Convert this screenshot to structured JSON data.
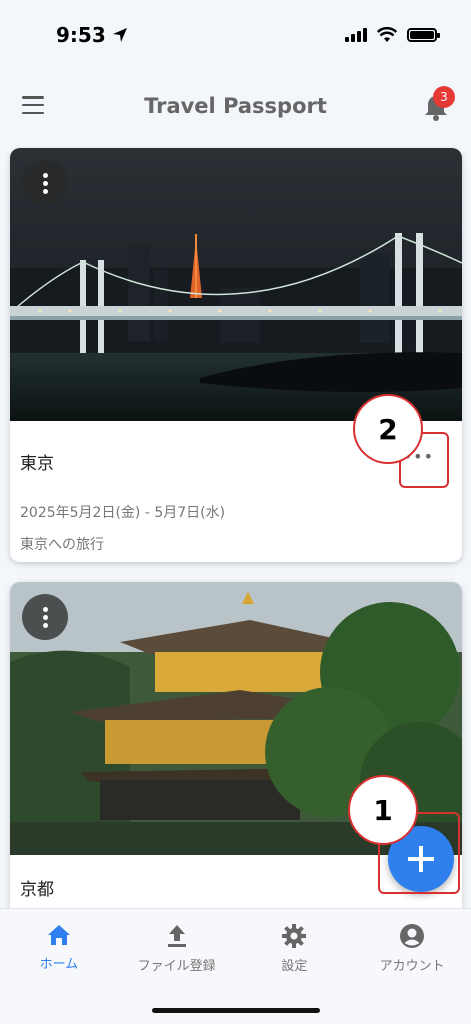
{
  "status_bar": {
    "time": "9:53"
  },
  "app_bar": {
    "title": "Travel Passport",
    "notification_count": "3"
  },
  "trips": [
    {
      "title": "東京",
      "dates": "2025年5月2日(金) - 5月7日(水)",
      "description": "東京への旅行",
      "more": "•••"
    },
    {
      "title": "京都",
      "more": "•••"
    }
  ],
  "annotations": {
    "first": "1",
    "second": "2"
  },
  "bottom_nav": [
    {
      "label": "ホーム",
      "icon": "home-icon",
      "active": true
    },
    {
      "label": "ファイル登録",
      "icon": "upload-icon"
    },
    {
      "label": "設定",
      "icon": "gear-icon"
    },
    {
      "label": "アカウント",
      "icon": "account-icon"
    }
  ],
  "colors": {
    "accent": "#2f80ed",
    "badge": "#e53935",
    "annotation": "#d83030"
  }
}
